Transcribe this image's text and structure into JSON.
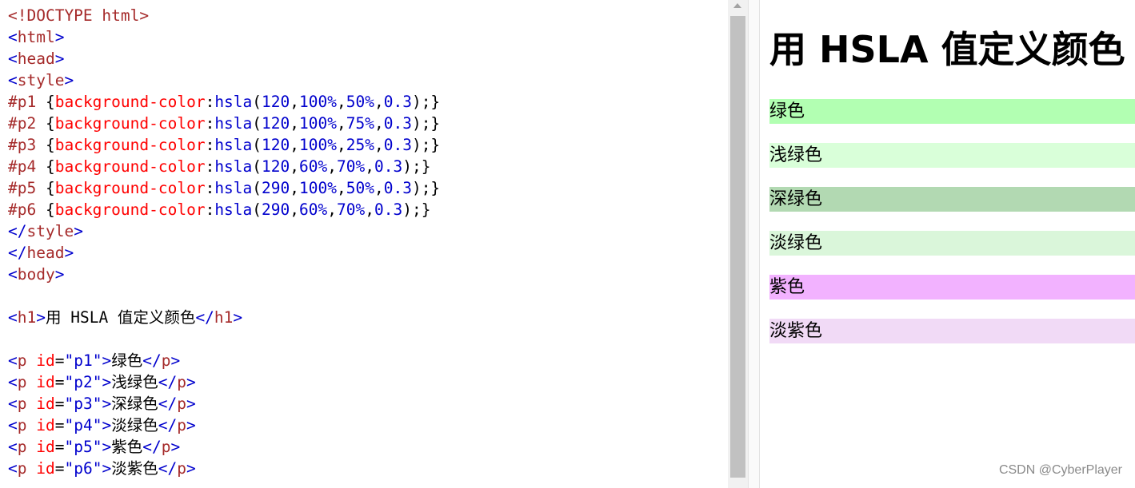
{
  "editor": {
    "lines": [
      [
        {
          "c": "tag",
          "t": "<!DOCTYPE html>"
        }
      ],
      [
        {
          "c": "br",
          "t": "<"
        },
        {
          "c": "tag",
          "t": "html"
        },
        {
          "c": "br",
          "t": ">"
        }
      ],
      [
        {
          "c": "br",
          "t": "<"
        },
        {
          "c": "tag",
          "t": "head"
        },
        {
          "c": "br",
          "t": ">"
        }
      ],
      [
        {
          "c": "br",
          "t": "<"
        },
        {
          "c": "tag",
          "t": "style"
        },
        {
          "c": "br",
          "t": ">"
        }
      ],
      [
        {
          "c": "sel",
          "t": "#p1 "
        },
        {
          "c": "punct",
          "t": "{"
        },
        {
          "c": "prop",
          "t": "background-color"
        },
        {
          "c": "punct",
          "t": ":"
        },
        {
          "c": "val",
          "t": "hsla"
        },
        {
          "c": "punct",
          "t": "("
        },
        {
          "c": "val",
          "t": "120"
        },
        {
          "c": "punct",
          "t": ","
        },
        {
          "c": "val",
          "t": "100%"
        },
        {
          "c": "punct",
          "t": ","
        },
        {
          "c": "val",
          "t": "50%"
        },
        {
          "c": "punct",
          "t": ","
        },
        {
          "c": "val",
          "t": "0.3"
        },
        {
          "c": "punct",
          "t": ");}"
        }
      ],
      [
        {
          "c": "sel",
          "t": "#p2 "
        },
        {
          "c": "punct",
          "t": "{"
        },
        {
          "c": "prop",
          "t": "background-color"
        },
        {
          "c": "punct",
          "t": ":"
        },
        {
          "c": "val",
          "t": "hsla"
        },
        {
          "c": "punct",
          "t": "("
        },
        {
          "c": "val",
          "t": "120"
        },
        {
          "c": "punct",
          "t": ","
        },
        {
          "c": "val",
          "t": "100%"
        },
        {
          "c": "punct",
          "t": ","
        },
        {
          "c": "val",
          "t": "75%"
        },
        {
          "c": "punct",
          "t": ","
        },
        {
          "c": "val",
          "t": "0.3"
        },
        {
          "c": "punct",
          "t": ");}"
        }
      ],
      [
        {
          "c": "sel",
          "t": "#p3 "
        },
        {
          "c": "punct",
          "t": "{"
        },
        {
          "c": "prop",
          "t": "background-color"
        },
        {
          "c": "punct",
          "t": ":"
        },
        {
          "c": "val",
          "t": "hsla"
        },
        {
          "c": "punct",
          "t": "("
        },
        {
          "c": "val",
          "t": "120"
        },
        {
          "c": "punct",
          "t": ","
        },
        {
          "c": "val",
          "t": "100%"
        },
        {
          "c": "punct",
          "t": ","
        },
        {
          "c": "val",
          "t": "25%"
        },
        {
          "c": "punct",
          "t": ","
        },
        {
          "c": "val",
          "t": "0.3"
        },
        {
          "c": "punct",
          "t": ");}"
        }
      ],
      [
        {
          "c": "sel",
          "t": "#p4 "
        },
        {
          "c": "punct",
          "t": "{"
        },
        {
          "c": "prop",
          "t": "background-color"
        },
        {
          "c": "punct",
          "t": ":"
        },
        {
          "c": "val",
          "t": "hsla"
        },
        {
          "c": "punct",
          "t": "("
        },
        {
          "c": "val",
          "t": "120"
        },
        {
          "c": "punct",
          "t": ","
        },
        {
          "c": "val",
          "t": "60%"
        },
        {
          "c": "punct",
          "t": ","
        },
        {
          "c": "val",
          "t": "70%"
        },
        {
          "c": "punct",
          "t": ","
        },
        {
          "c": "val",
          "t": "0.3"
        },
        {
          "c": "punct",
          "t": ");}"
        }
      ],
      [
        {
          "c": "sel",
          "t": "#p5 "
        },
        {
          "c": "punct",
          "t": "{"
        },
        {
          "c": "prop",
          "t": "background-color"
        },
        {
          "c": "punct",
          "t": ":"
        },
        {
          "c": "val",
          "t": "hsla"
        },
        {
          "c": "punct",
          "t": "("
        },
        {
          "c": "val",
          "t": "290"
        },
        {
          "c": "punct",
          "t": ","
        },
        {
          "c": "val",
          "t": "100%"
        },
        {
          "c": "punct",
          "t": ","
        },
        {
          "c": "val",
          "t": "50%"
        },
        {
          "c": "punct",
          "t": ","
        },
        {
          "c": "val",
          "t": "0.3"
        },
        {
          "c": "punct",
          "t": ");}"
        }
      ],
      [
        {
          "c": "sel",
          "t": "#p6 "
        },
        {
          "c": "punct",
          "t": "{"
        },
        {
          "c": "prop",
          "t": "background-color"
        },
        {
          "c": "punct",
          "t": ":"
        },
        {
          "c": "val",
          "t": "hsla"
        },
        {
          "c": "punct",
          "t": "("
        },
        {
          "c": "val",
          "t": "290"
        },
        {
          "c": "punct",
          "t": ","
        },
        {
          "c": "val",
          "t": "60%"
        },
        {
          "c": "punct",
          "t": ","
        },
        {
          "c": "val",
          "t": "70%"
        },
        {
          "c": "punct",
          "t": ","
        },
        {
          "c": "val",
          "t": "0.3"
        },
        {
          "c": "punct",
          "t": ");}"
        }
      ],
      [
        {
          "c": "br",
          "t": "</"
        },
        {
          "c": "tag",
          "t": "style"
        },
        {
          "c": "br",
          "t": ">"
        }
      ],
      [
        {
          "c": "br",
          "t": "</"
        },
        {
          "c": "tag",
          "t": "head"
        },
        {
          "c": "br",
          "t": ">"
        }
      ],
      [
        {
          "c": "br",
          "t": "<"
        },
        {
          "c": "tag",
          "t": "body"
        },
        {
          "c": "br",
          "t": ">"
        }
      ],
      [],
      [
        {
          "c": "br",
          "t": "<"
        },
        {
          "c": "tag",
          "t": "h1"
        },
        {
          "c": "br",
          "t": ">"
        },
        {
          "c": "txt",
          "t": "用 HSLA 值定义颜色"
        },
        {
          "c": "br",
          "t": "</"
        },
        {
          "c": "tag",
          "t": "h1"
        },
        {
          "c": "br",
          "t": ">"
        }
      ],
      [],
      [
        {
          "c": "br",
          "t": "<"
        },
        {
          "c": "tag",
          "t": "p "
        },
        {
          "c": "attr",
          "t": "id"
        },
        {
          "c": "punct",
          "t": "="
        },
        {
          "c": "aval",
          "t": "\"p1\""
        },
        {
          "c": "br",
          "t": ">"
        },
        {
          "c": "txt",
          "t": "绿色"
        },
        {
          "c": "br",
          "t": "</"
        },
        {
          "c": "tag",
          "t": "p"
        },
        {
          "c": "br",
          "t": ">"
        }
      ],
      [
        {
          "c": "br",
          "t": "<"
        },
        {
          "c": "tag",
          "t": "p "
        },
        {
          "c": "attr",
          "t": "id"
        },
        {
          "c": "punct",
          "t": "="
        },
        {
          "c": "aval",
          "t": "\"p2\""
        },
        {
          "c": "br",
          "t": ">"
        },
        {
          "c": "txt",
          "t": "浅绿色"
        },
        {
          "c": "br",
          "t": "</"
        },
        {
          "c": "tag",
          "t": "p"
        },
        {
          "c": "br",
          "t": ">"
        }
      ],
      [
        {
          "c": "br",
          "t": "<"
        },
        {
          "c": "tag",
          "t": "p "
        },
        {
          "c": "attr",
          "t": "id"
        },
        {
          "c": "punct",
          "t": "="
        },
        {
          "c": "aval",
          "t": "\"p3\""
        },
        {
          "c": "br",
          "t": ">"
        },
        {
          "c": "txt",
          "t": "深绿色"
        },
        {
          "c": "br",
          "t": "</"
        },
        {
          "c": "tag",
          "t": "p"
        },
        {
          "c": "br",
          "t": ">"
        }
      ],
      [
        {
          "c": "br",
          "t": "<"
        },
        {
          "c": "tag",
          "t": "p "
        },
        {
          "c": "attr",
          "t": "id"
        },
        {
          "c": "punct",
          "t": "="
        },
        {
          "c": "aval",
          "t": "\"p4\""
        },
        {
          "c": "br",
          "t": ">"
        },
        {
          "c": "txt",
          "t": "淡绿色"
        },
        {
          "c": "br",
          "t": "</"
        },
        {
          "c": "tag",
          "t": "p"
        },
        {
          "c": "br",
          "t": ">"
        }
      ],
      [
        {
          "c": "br",
          "t": "<"
        },
        {
          "c": "tag",
          "t": "p "
        },
        {
          "c": "attr",
          "t": "id"
        },
        {
          "c": "punct",
          "t": "="
        },
        {
          "c": "aval",
          "t": "\"p5\""
        },
        {
          "c": "br",
          "t": ">"
        },
        {
          "c": "txt",
          "t": "紫色"
        },
        {
          "c": "br",
          "t": "</"
        },
        {
          "c": "tag",
          "t": "p"
        },
        {
          "c": "br",
          "t": ">"
        }
      ],
      [
        {
          "c": "br",
          "t": "<"
        },
        {
          "c": "tag",
          "t": "p "
        },
        {
          "c": "attr",
          "t": "id"
        },
        {
          "c": "punct",
          "t": "="
        },
        {
          "c": "aval",
          "t": "\"p6\""
        },
        {
          "c": "br",
          "t": ">"
        },
        {
          "c": "txt",
          "t": "淡紫色"
        },
        {
          "c": "br",
          "t": "</"
        },
        {
          "c": "tag",
          "t": "p"
        },
        {
          "c": "br",
          "t": ">"
        }
      ]
    ]
  },
  "preview": {
    "heading": "用 HSLA 值定义颜色",
    "paragraphs": [
      {
        "id": "p1",
        "text": "绿色",
        "bg": "hsla(120,100%,50%,0.3)"
      },
      {
        "id": "p2",
        "text": "浅绿色",
        "bg": "hsla(120,100%,75%,0.3)"
      },
      {
        "id": "p3",
        "text": "深绿色",
        "bg": "hsla(120,100%,25%,0.3)"
      },
      {
        "id": "p4",
        "text": "淡绿色",
        "bg": "hsla(120,60%,70%,0.3)"
      },
      {
        "id": "p5",
        "text": "紫色",
        "bg": "hsla(290,100%,50%,0.3)"
      },
      {
        "id": "p6",
        "text": "淡紫色",
        "bg": "hsla(290,60%,70%,0.3)"
      }
    ]
  },
  "watermark": "CSDN @CyberPlayer"
}
